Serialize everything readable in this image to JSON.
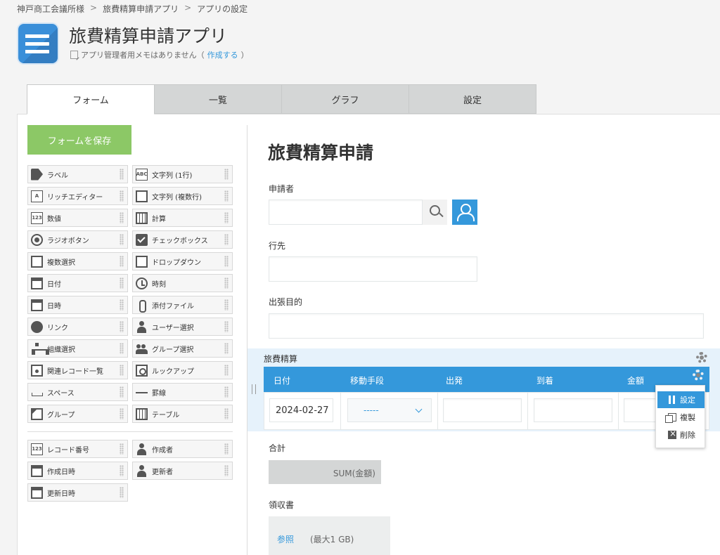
{
  "breadcrumb": {
    "items": [
      "神戸商工会議所様",
      "旅費精算申請アプリ",
      "アプリの設定"
    ],
    "separator": ">"
  },
  "app": {
    "title": "旅費精算申請アプリ",
    "memo_text": "アプリ管理者用メモはありません（",
    "memo_link": "作成する",
    "memo_close": "）"
  },
  "tabs": [
    "フォーム",
    "一覧",
    "グラフ",
    "設定"
  ],
  "palette": {
    "save_label": "フォームを保存",
    "left": [
      "ラベル",
      "リッチエディター",
      "数値",
      "ラジオボタン",
      "複数選択",
      "日付",
      "日時",
      "リンク",
      "組織選択",
      "関連レコード一覧",
      "スペース",
      "グループ"
    ],
    "right": [
      "文字列 (1行)",
      "文字列 (複数行)",
      "計算",
      "チェックボックス",
      "ドロップダウン",
      "時刻",
      "添付ファイル",
      "ユーザー選択",
      "グループ選択",
      "ルックアップ",
      "罫線",
      "テーブル"
    ],
    "system_left": [
      "レコード番号",
      "作成日時",
      "更新日時"
    ],
    "system_right": [
      "作成者",
      "更新者"
    ],
    "icons": {
      "abc": "ABC",
      "num": "123",
      "a": "A"
    }
  },
  "form": {
    "title": "旅費精算申請",
    "applicant_label": "申請者",
    "destination_label": "行先",
    "purpose_label": "出張目的",
    "table": {
      "label": "旅費精算",
      "headers": [
        "日付",
        "移動手段",
        "出発",
        "到着",
        "金額"
      ],
      "date_value": "2024-02-27",
      "select_value": "-----"
    },
    "total_label": "合計",
    "total_value": "SUM(金額)",
    "receipt_label": "領収書",
    "attach_link": "参照",
    "attach_limit": "(最大1 GB)"
  },
  "context_menu": [
    "設定",
    "複製",
    "削除"
  ],
  "colors": {
    "accent": "#3498db",
    "save_button": "#8cc866",
    "table_header": "#3498db"
  }
}
